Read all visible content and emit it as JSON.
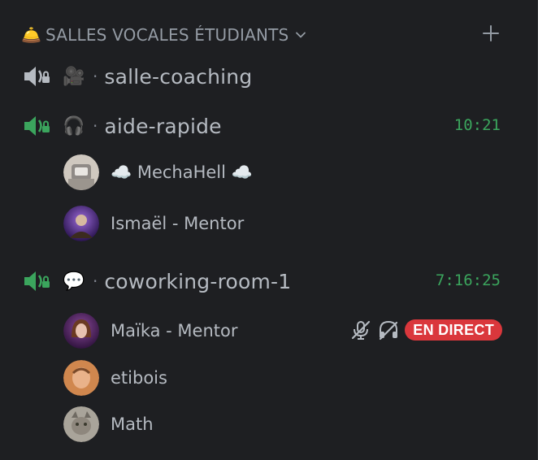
{
  "category": {
    "emoji": "🛎️",
    "label": "SALLES VOCALES ÉTUDIANTS",
    "chevron_icon": "chevron-down-icon",
    "add_icon": "plus-icon"
  },
  "channels": [
    {
      "emoji": "🎥",
      "dot": "·",
      "name": "salle-coaching",
      "speaker_color": "#b5bac1",
      "time": ""
    },
    {
      "emoji": "🎧",
      "dot": "·",
      "name": "aide-rapide",
      "speaker_color": "#3ba55d",
      "time": "10:21",
      "users": [
        {
          "name": "☁️ MechaHell ☁️",
          "avatar_color": "#a8a29a"
        },
        {
          "name": "Ismaël - Mentor",
          "avatar_color": "#6b3fa0"
        }
      ]
    },
    {
      "emoji": "💬",
      "dot": "·",
      "name": "coworking-room-1",
      "speaker_color": "#3ba55d",
      "time": "7:16:25",
      "users": [
        {
          "name": "Maïka - Mentor",
          "avatar_color": "#5a2a6e",
          "muted": true,
          "deafened": true,
          "live_label": "EN DIRECT"
        },
        {
          "name": "etibois",
          "avatar_color": "#c46a3a"
        },
        {
          "name": "Math",
          "avatar_color": "#8a8a86"
        }
      ]
    }
  ],
  "colors": {
    "background": "#1e1f22",
    "live_red": "#da373c",
    "timer_green": "#3ba55d"
  }
}
